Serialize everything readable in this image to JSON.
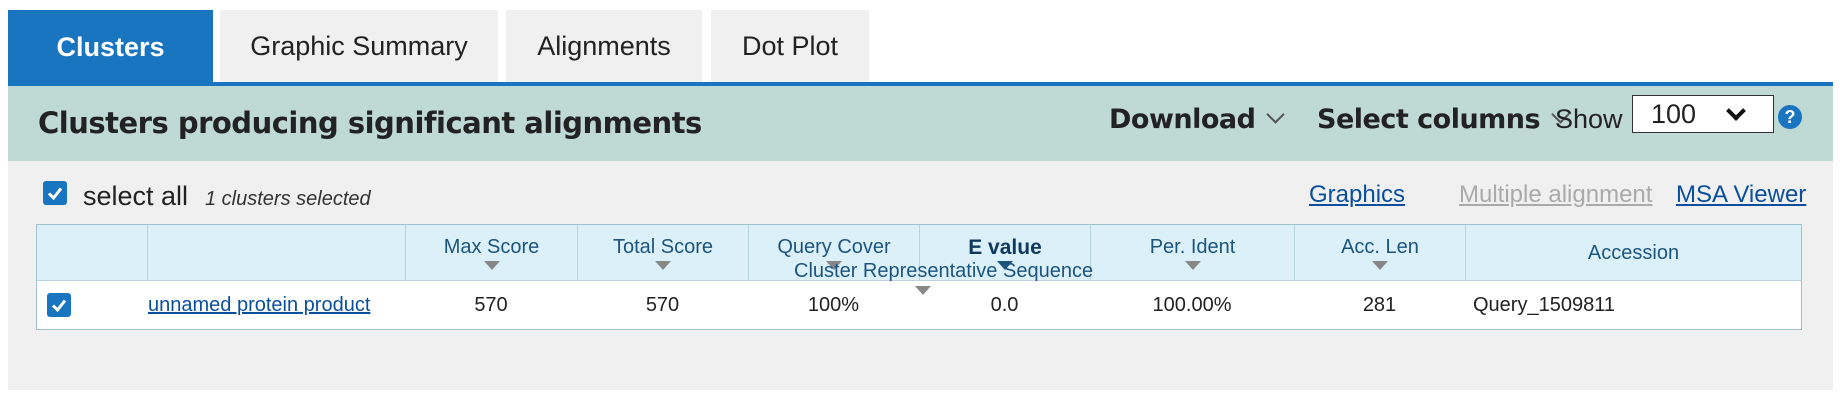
{
  "tabs": [
    "Clusters",
    "Graphic Summary",
    "Alignments",
    "Dot Plot"
  ],
  "header": {
    "title": "Clusters producing significant alignments",
    "download": "Download",
    "select_columns": "Select columns",
    "show_label": "Show",
    "show_value": "100",
    "help": "?"
  },
  "selection": {
    "select_all": "select all",
    "count": "1 clusters selected"
  },
  "links": {
    "graphics": "Graphics",
    "multiple_alignment": "Multiple alignment",
    "msa_viewer": "MSA Viewer"
  },
  "table": {
    "columns": [
      "",
      "",
      "Max Score",
      "Total Score",
      "Query Cover",
      "E value",
      "Per. Ident",
      "Acc. Len",
      "Accession"
    ],
    "overlay_header": "Cluster Representative Sequence",
    "rows": [
      {
        "description": "unnamed protein product",
        "max_score": "570",
        "total_score": "570",
        "query_cover": "100%",
        "e_value": "0.0",
        "per_ident": "100.00%",
        "acc_len": "281",
        "accession": "Query_1509811"
      }
    ]
  },
  "colors": {
    "accent": "#1a75c1",
    "header_bar": "#bfd9d5",
    "table_header": "#dcf0f9",
    "link": "#0a4f9e"
  }
}
